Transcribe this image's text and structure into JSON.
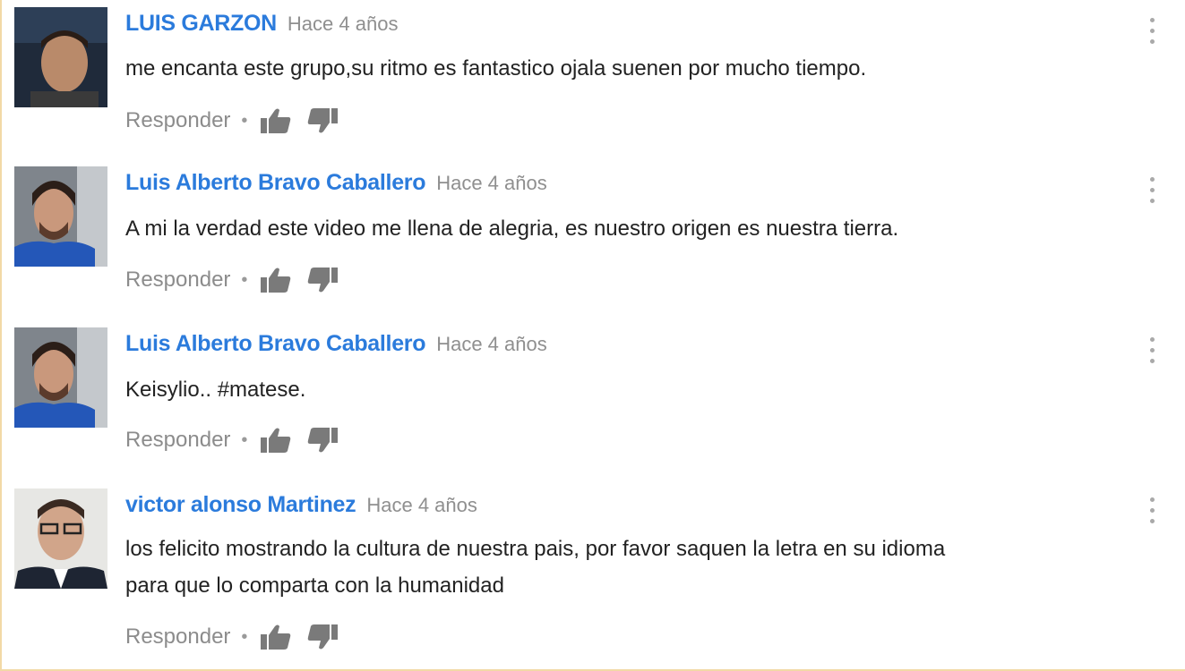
{
  "comments": [
    {
      "author": "LUIS GARZON",
      "time": "Hace 4 años",
      "text": "me encanta este grupo,su ritmo es fantastico ojala suenen por mucho tiempo.",
      "reply_label": "Responder",
      "separator": "•",
      "avatar_icon": "user-avatar-dark-background"
    },
    {
      "author": "Luis Alberto Bravo Caballero",
      "time": "Hace 4 años",
      "text": "A mi la verdad este video me llena de alegria, es nuestro origen es nuestra tierra.",
      "reply_label": "Responder",
      "separator": "•",
      "avatar_icon": "user-avatar-blue-shirt"
    },
    {
      "author": "Luis Alberto Bravo Caballero",
      "time": "Hace 4 años",
      "text": "Keisylio.. #matese.",
      "reply_label": "Responder",
      "separator": "•",
      "avatar_icon": "user-avatar-blue-shirt"
    },
    {
      "author": "victor alonso Martinez",
      "time": "Hace 4 años",
      "text": "los felicito mostrando la cultura de nuestra pais, por favor saquen la letra en su idioma\npara que lo comparta con la humanidad",
      "reply_label": "Responder",
      "separator": "•",
      "avatar_icon": "user-avatar-suit-glasses"
    }
  ],
  "colors": {
    "author": "#2b7bdc",
    "timestamp": "#8f8f8f",
    "text": "#222222",
    "muted": "#8c8c8c",
    "icon": "#7a7a7a"
  }
}
